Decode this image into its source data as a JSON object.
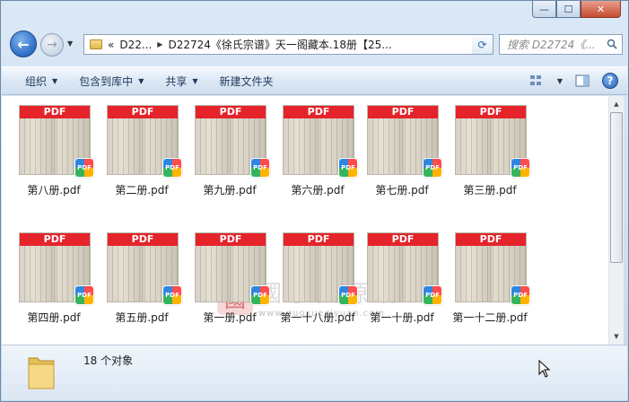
{
  "window": {
    "minimize_glyph": "—",
    "maximize_glyph": "☐",
    "close_glyph": "✕"
  },
  "nav": {
    "back_glyph": "←",
    "forward_glyph": "→",
    "breadcrumb_prefix": "«",
    "crumbs": [
      "D22...",
      "D22724《徐氏宗谱》天一阁藏本.18册【25..."
    ],
    "refresh_glyph": "⟳",
    "search_placeholder": "搜索 D22724《..."
  },
  "toolbar": {
    "organize": "组织",
    "include_library": "包含到库中",
    "share": "共享",
    "new_folder": "新建文件夹"
  },
  "files": [
    {
      "name": "第八册.pdf"
    },
    {
      "name": "第二册.pdf"
    },
    {
      "name": "第九册.pdf"
    },
    {
      "name": "第六册.pdf"
    },
    {
      "name": "第七册.pdf"
    },
    {
      "name": "第三册.pdf"
    },
    {
      "name": "第四册.pdf"
    },
    {
      "name": "第五册.pdf"
    },
    {
      "name": "第一册.pdf"
    },
    {
      "name": "第一十八册.pdf"
    },
    {
      "name": "第一十册.pdf"
    },
    {
      "name": "第一十二册.pdf"
    }
  ],
  "thumbnail_band_text": "PDF",
  "badge_text": "PDF",
  "watermark": {
    "seal": "國",
    "title": "國學資源網",
    "url": "www.guoxueziyuan.com"
  },
  "details": {
    "count_text": "18 个对象"
  },
  "colors": {
    "pdf_band": "#e5232b",
    "window_chrome": "#dbe8f6"
  }
}
